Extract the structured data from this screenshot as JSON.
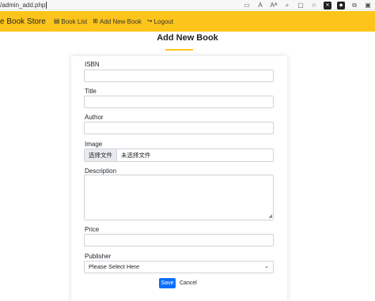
{
  "browser": {
    "url": "/admin_add.php",
    "icons": [
      "tab-icon",
      "read-aloud-icon",
      "font-size-icon",
      "zoom-icon",
      "reader-icon",
      "favorite-icon",
      "extension-x-icon",
      "extension-d-icon",
      "extension-icon",
      "collections-icon"
    ]
  },
  "navbar": {
    "brand": "e Book Store",
    "items": [
      {
        "label": "Book List",
        "icon": "list-icon"
      },
      {
        "label": "Add New Book",
        "icon": "plus-square-icon"
      },
      {
        "label": "Logout",
        "icon": "logout-icon"
      }
    ],
    "accent_color": "#fdc51b"
  },
  "page": {
    "title": "Add New Book"
  },
  "form": {
    "isbn_label": "ISBN",
    "isbn_value": "",
    "title_label": "Title",
    "title_value": "",
    "author_label": "Author",
    "author_value": "",
    "image_label": "Image",
    "image_button": "选择文件",
    "image_status": "未选择文件",
    "description_label": "Description",
    "description_value": "",
    "price_label": "Price",
    "price_value": "",
    "publisher_label": "Publisher",
    "publisher_selected": "Please Select Here",
    "save_label": "Save",
    "cancel_label": "Cancel",
    "save_color": "#0d6efd"
  }
}
